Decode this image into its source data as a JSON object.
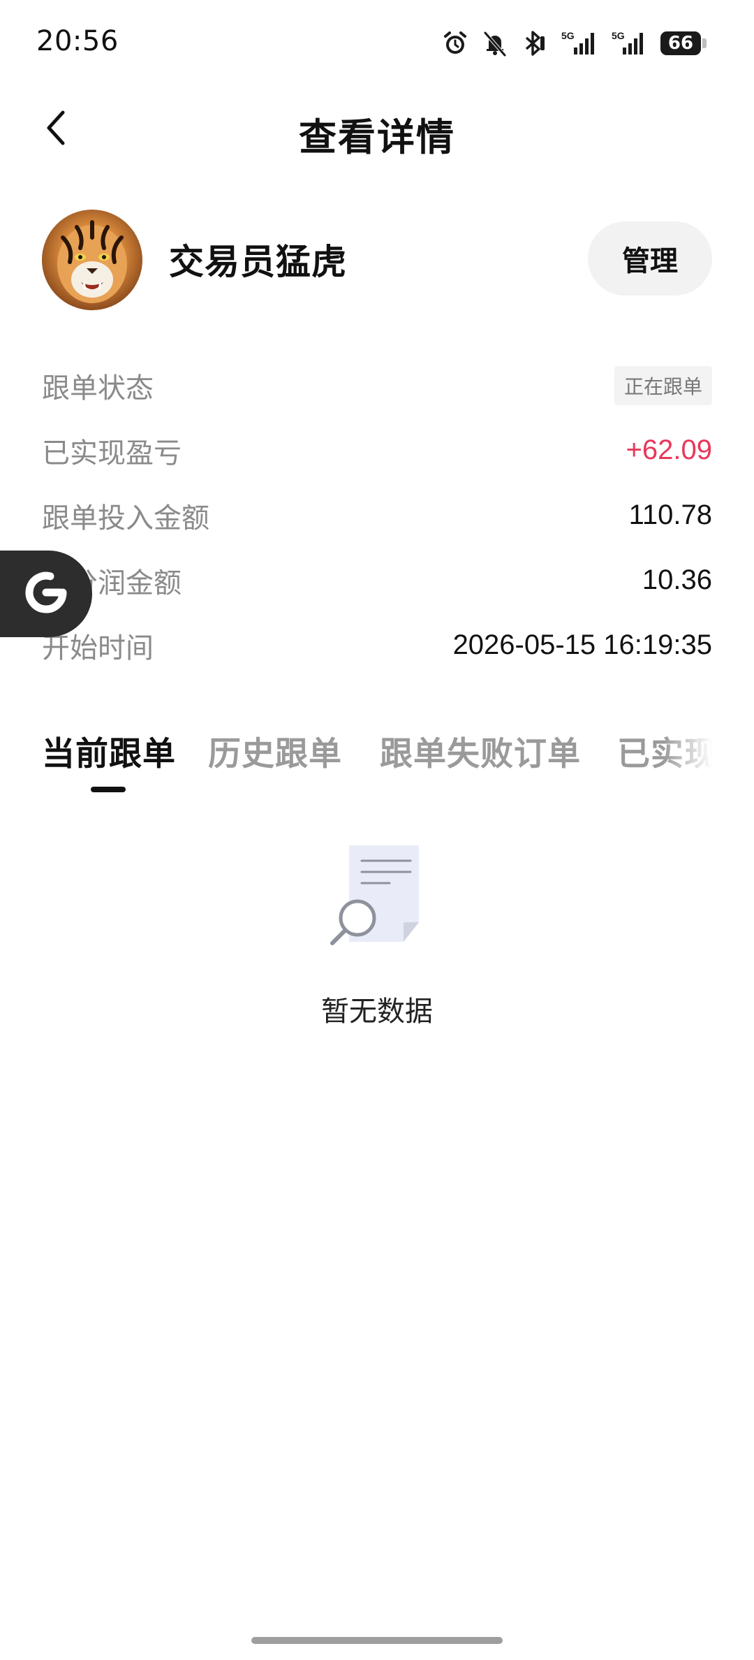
{
  "status_bar": {
    "time": "20:56",
    "network_1": "5G",
    "network_2": "5G",
    "battery": "66",
    "icons": [
      "alarm-icon",
      "mute-bell-icon",
      "bluetooth-icon",
      "signal-5g-icon",
      "signal-5g-icon",
      "battery-icon"
    ]
  },
  "header": {
    "title": "查看详情",
    "back_icon": "chevron-left-icon"
  },
  "trader": {
    "name": "交易员猛虎",
    "manage_label": "管理"
  },
  "info": {
    "rows": [
      {
        "label": "跟单状态",
        "value": "正在跟单"
      },
      {
        "label": "已实现盈亏",
        "value": "+62.09"
      },
      {
        "label": "跟单投入金额",
        "value": "110.78"
      },
      {
        "label": "已分润金额",
        "value": "10.36"
      },
      {
        "label": "开始时间",
        "value": "2026-05-15 16:19:35"
      }
    ]
  },
  "tabs": [
    {
      "label": "当前跟单",
      "active": true
    },
    {
      "label": "历史跟单",
      "active": false
    },
    {
      "label": "跟单失败订单",
      "active": false
    },
    {
      "label": "已实现",
      "active": false
    }
  ],
  "empty_state": {
    "icon": "document-search-icon",
    "text": "暂无数据"
  },
  "colors": {
    "profit": "#e8365a",
    "label_gray": "#8a8a8a",
    "tab_inactive": "#9a9a9a"
  }
}
